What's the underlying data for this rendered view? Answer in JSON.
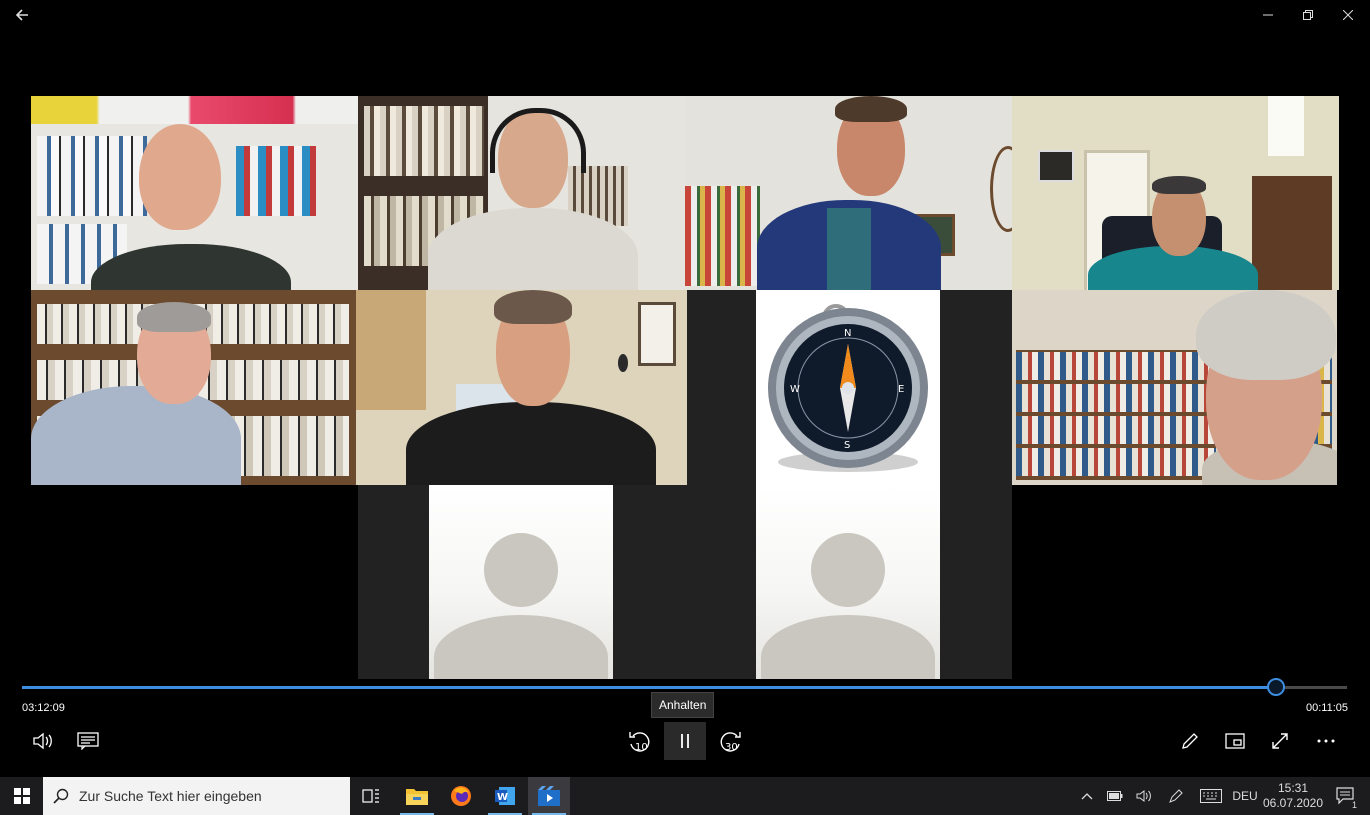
{
  "window": {
    "back_icon": "arrow-left-icon",
    "minimize_icon": "minimize-icon",
    "restore_icon": "restore-icon",
    "close_icon": "close-icon"
  },
  "participants": [
    {
      "kind": "video"
    },
    {
      "kind": "video"
    },
    {
      "kind": "video"
    },
    {
      "kind": "video"
    },
    {
      "kind": "video"
    },
    {
      "kind": "video"
    },
    {
      "kind": "image",
      "icon": "compass-icon"
    },
    {
      "kind": "video"
    },
    {
      "kind": "avatar"
    },
    {
      "kind": "avatar"
    }
  ],
  "player": {
    "elapsed": "03:12:09",
    "remaining": "00:11:05",
    "progress": 0.946,
    "tooltip": "Anhalten",
    "skip_back": "10",
    "skip_forward": "30",
    "accent": "#3d8ee0",
    "icons": {
      "volume": "volume-icon",
      "subtitles": "subtitles-icon",
      "pause": "pause-icon",
      "edit": "pencil-icon",
      "mini_view": "mini-view-icon",
      "fullscreen": "fullscreen-icon",
      "more": "more-icon"
    }
  },
  "taskbar": {
    "search_placeholder": "Zur Suche Text hier eingeben",
    "language": "DEU",
    "time": "15:31",
    "date": "06.07.2020",
    "notification_count": "1",
    "apps": [
      "task-view-icon",
      "file-explorer-icon",
      "firefox-icon",
      "word-icon",
      "movies-tv-icon"
    ]
  }
}
